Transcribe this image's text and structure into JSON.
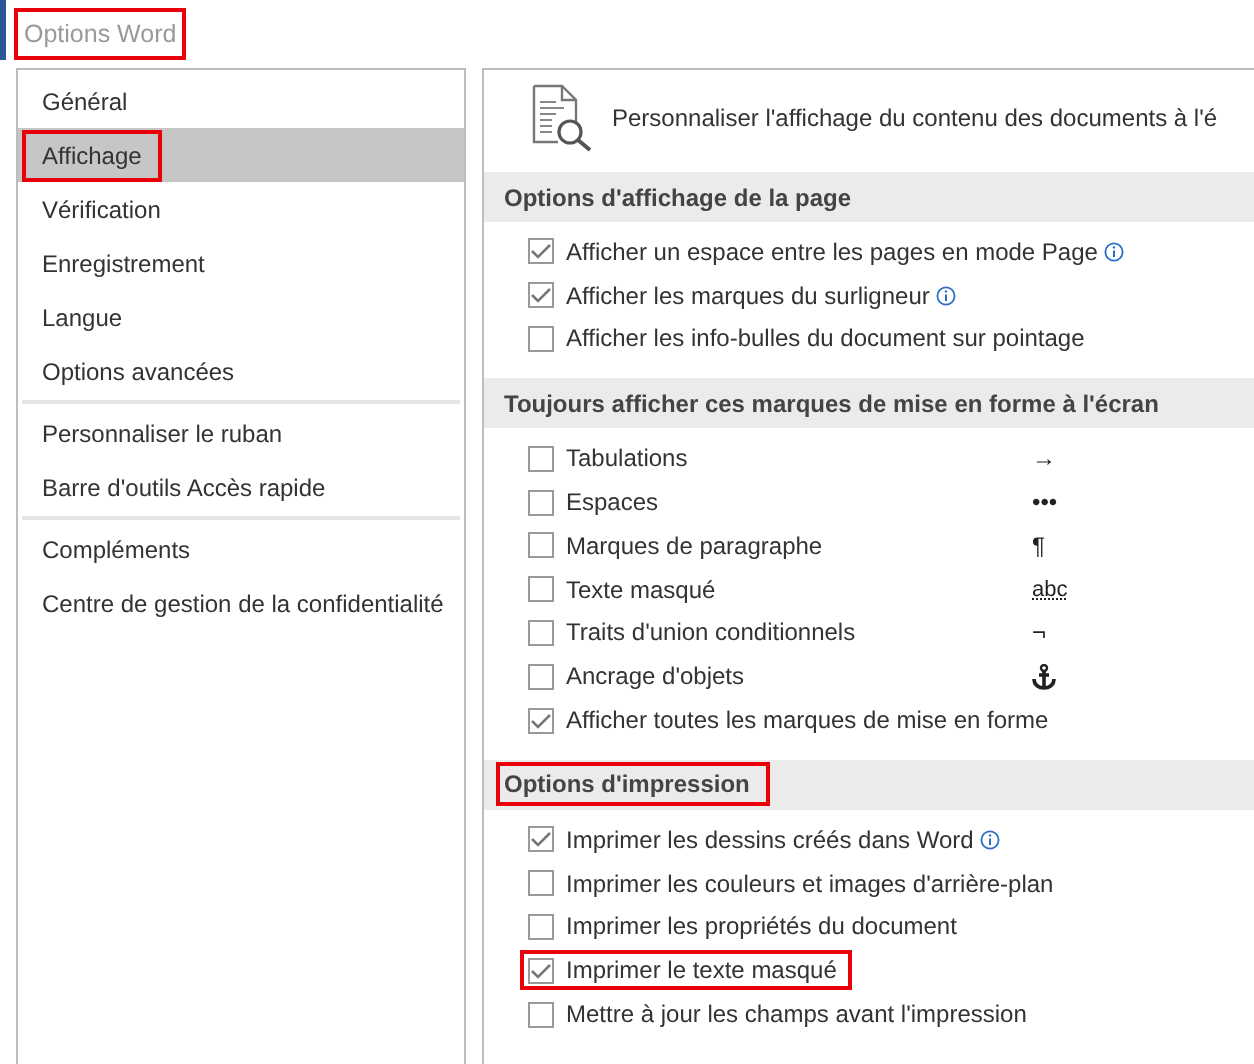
{
  "window": {
    "title": "Options Word",
    "highlighted": true
  },
  "sidebar": {
    "groups": [
      {
        "items": [
          {
            "label": "Général",
            "selected": false,
            "highlighted": false
          },
          {
            "label": "Affichage",
            "selected": true,
            "highlighted": true
          },
          {
            "label": "Vérification",
            "selected": false,
            "highlighted": false
          },
          {
            "label": "Enregistrement",
            "selected": false,
            "highlighted": false
          },
          {
            "label": "Langue",
            "selected": false,
            "highlighted": false
          },
          {
            "label": "Options avancées",
            "selected": false,
            "highlighted": false
          }
        ]
      },
      {
        "items": [
          {
            "label": "Personnaliser le ruban",
            "selected": false,
            "highlighted": false
          },
          {
            "label": "Barre d'outils Accès rapide",
            "selected": false,
            "highlighted": false
          }
        ]
      },
      {
        "items": [
          {
            "label": "Compléments",
            "selected": false,
            "highlighted": false
          },
          {
            "label": "Centre de gestion de la confidentialité",
            "selected": false,
            "highlighted": false
          }
        ]
      }
    ]
  },
  "content": {
    "header": "Personnaliser l'affichage du contenu des documents à l'é",
    "sections": [
      {
        "title": "Options d'affichage de la page",
        "highlighted": false,
        "options": [
          {
            "kind": "plain",
            "label": "Afficher un espace entre les pages en mode Page",
            "checked": true,
            "info": true,
            "highlighted": false
          },
          {
            "kind": "plain",
            "label": "Afficher les marques du surligneur",
            "checked": true,
            "info": true,
            "highlighted": false
          },
          {
            "kind": "plain",
            "label": "Afficher les info-bulles du document sur pointage",
            "checked": false,
            "info": false,
            "highlighted": false
          }
        ]
      },
      {
        "title": "Toujours afficher ces marques de mise en forme à l'écran",
        "highlighted": false,
        "options": [
          {
            "kind": "symbol",
            "label": "Tabulations",
            "symbol": "→",
            "checked": false,
            "info": false,
            "highlighted": false
          },
          {
            "kind": "symbol",
            "label": "Espaces",
            "symbol": "•••",
            "checked": false,
            "info": false,
            "highlighted": false
          },
          {
            "kind": "symbol",
            "label": "Marques de paragraphe",
            "symbol": "¶",
            "checked": false,
            "info": false,
            "highlighted": false
          },
          {
            "kind": "symbol",
            "label": "Texte masqué",
            "symbol": "abc",
            "checked": false,
            "info": false,
            "highlighted": false
          },
          {
            "kind": "symbol",
            "label": "Traits d'union conditionnels",
            "symbol": "¬",
            "checked": false,
            "info": false,
            "highlighted": false
          },
          {
            "kind": "anchor",
            "label": "Ancrage d'objets",
            "checked": false,
            "info": false,
            "highlighted": false
          },
          {
            "kind": "plain",
            "label": "Afficher toutes les marques de mise en forme",
            "checked": true,
            "info": false,
            "highlighted": false
          }
        ]
      },
      {
        "title": "Options d'impression",
        "highlighted": true,
        "options": [
          {
            "kind": "plain",
            "label": "Imprimer les dessins créés dans Word",
            "checked": true,
            "info": true,
            "highlighted": false
          },
          {
            "kind": "plain",
            "label": "Imprimer les couleurs et images d'arrière-plan",
            "checked": false,
            "info": false,
            "highlighted": false
          },
          {
            "kind": "plain",
            "label": "Imprimer les propriétés du document",
            "checked": false,
            "info": false,
            "highlighted": false
          },
          {
            "kind": "plain",
            "label": "Imprimer le texte masqué",
            "checked": true,
            "info": false,
            "highlighted": true
          },
          {
            "kind": "plain",
            "label": "Mettre à jour les champs avant l'impression",
            "checked": false,
            "info": false,
            "highlighted": false
          }
        ]
      }
    ]
  }
}
